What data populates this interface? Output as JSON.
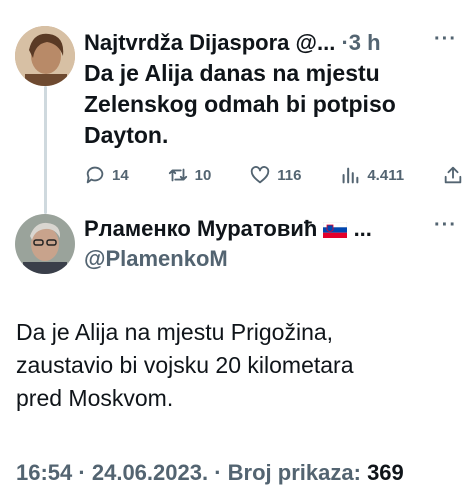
{
  "tweet1": {
    "display_name": "Najtvrdža Dijaspora @...",
    "time_sep": "·",
    "time": "3 h",
    "more": "···",
    "text_lines": [
      "Da je Alija danas na mjestu",
      "Zelenskog odmah bi potpiso",
      "Dayton."
    ],
    "actions": {
      "replies": "14",
      "retweets": "10",
      "likes": "116",
      "views": "4.411"
    }
  },
  "tweet2": {
    "display_name": "Рламенко Муратовић",
    "ellipsis": "...",
    "more": "···",
    "handle": "@PlamenkoM",
    "text_lines": [
      "Da je Alija na mjestu Prigožina,",
      "zaustavio bi vojsku 20 kilometara",
      "pred Moskvom."
    ],
    "time": "16:54",
    "date": "24.06.2023.",
    "views_label": "Broj prikaza:",
    "views_count": "369"
  },
  "colors": {
    "text": "#0f1419",
    "muted": "#536471",
    "thread_line": "#cfd9de"
  },
  "icons": [
    "reply-icon",
    "retweet-icon",
    "like-icon",
    "views-icon",
    "share-icon",
    "slovenia-flag-icon"
  ]
}
